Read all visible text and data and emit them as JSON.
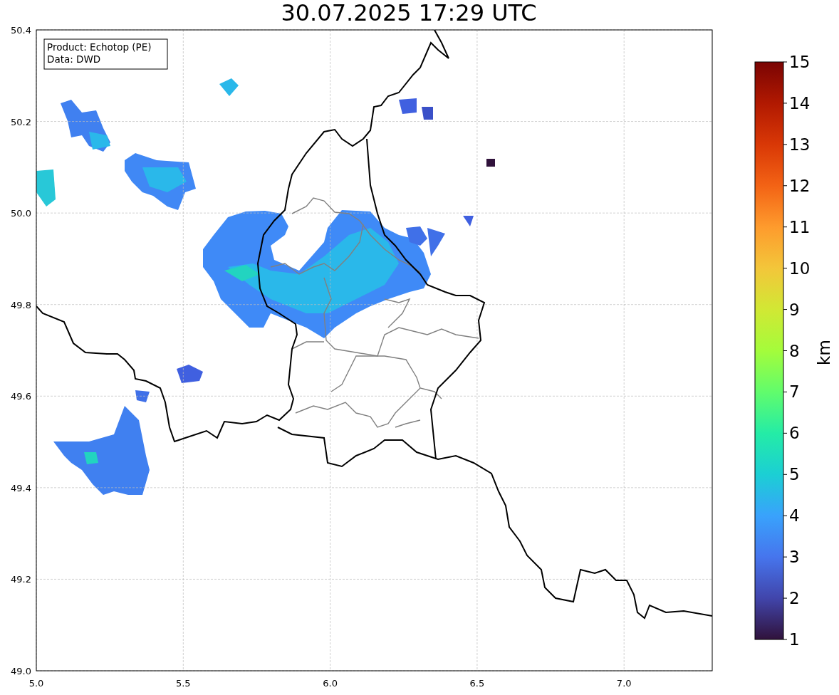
{
  "title": "30.07.2025 17:29 UTC",
  "legend": [
    "Product: Echotop (PE)",
    "Data: DWD"
  ],
  "map": {
    "x_ticks": [
      "5.0",
      "5.5",
      "6.0",
      "6.5",
      "7.0"
    ],
    "y_ticks": [
      "50.4",
      "50.2",
      "50.0",
      "49.8",
      "49.6",
      "49.4",
      "49.2",
      "49.0"
    ]
  },
  "colorbar": {
    "ticks": [
      "15",
      "14",
      "13",
      "12",
      "11",
      "10",
      "9",
      "8",
      "7",
      "6",
      "5",
      "4",
      "3",
      "2",
      "1"
    ],
    "label": "km"
  }
}
